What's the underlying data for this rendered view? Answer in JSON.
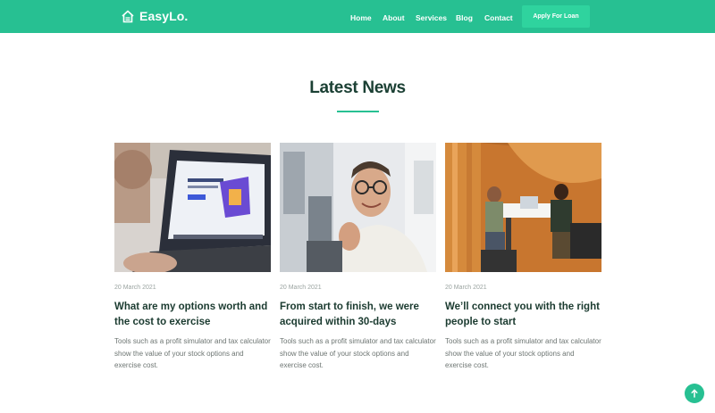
{
  "brand": {
    "name": "EasyLo.",
    "icon": "house-icon",
    "accent": "#27c092"
  },
  "nav": {
    "items": [
      {
        "label": "Home"
      },
      {
        "label": "About"
      },
      {
        "label": "Services"
      },
      {
        "label": "Blog"
      },
      {
        "label": "Contact"
      }
    ],
    "cta_label": "Apply For Loan"
  },
  "section": {
    "title": "Latest News"
  },
  "cards": [
    {
      "date": "20 March 2021",
      "title": "What are my options worth and the cost to exercise",
      "text": "Tools such as a profit simulator and tax calculator show the value of your stock options and exercise cost.",
      "image": "laptop-photo"
    },
    {
      "date": "20 March 2021",
      "title": "From start to finish, we were acquired within 30-days",
      "text": "Tools such as a profit simulator and tax calculator show the value of your stock options and exercise cost.",
      "image": "smiling-man-photo"
    },
    {
      "date": "20 March 2021",
      "title": "We’ll connect you with the right people to start",
      "text": "Tools such as a profit simulator and tax calculator show the value of your stock options and exercise cost.",
      "image": "meeting-booth-photo"
    }
  ],
  "back_to_top": {
    "icon": "arrow-up-icon"
  }
}
